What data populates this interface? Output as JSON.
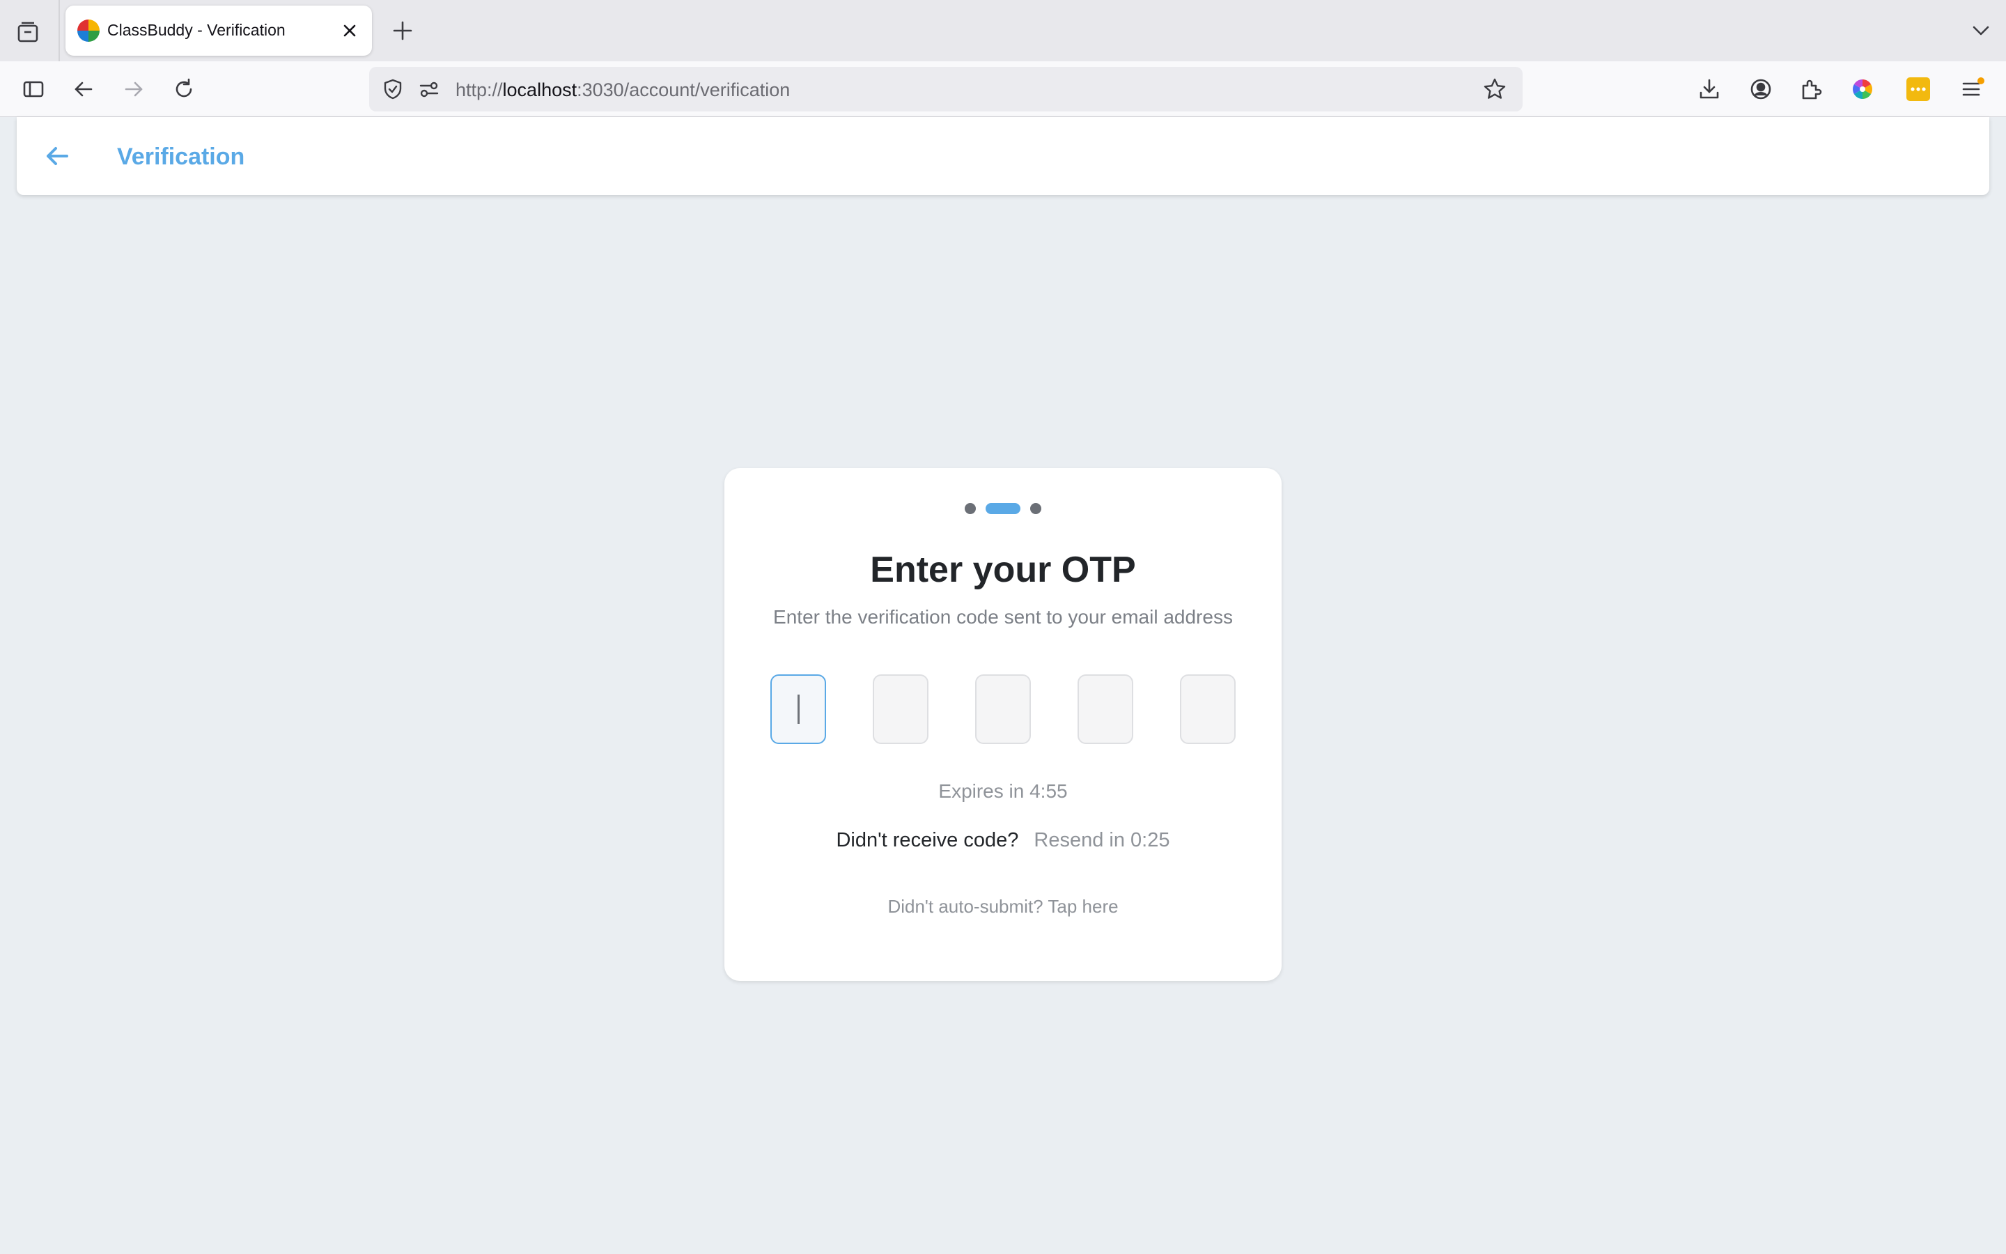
{
  "browser": {
    "tab": {
      "title": "ClassBuddy - Verification"
    },
    "url": {
      "scheme": "http://",
      "host": "localhost",
      "rest": ":3030/account/verification"
    },
    "icons": {
      "tab_tray": "tab-tray-icon",
      "close_tab": "close-icon",
      "new_tab": "plus-icon",
      "tab_list": "chevron-down-icon",
      "sidebar": "sidebar-icon",
      "back": "arrow-left-icon",
      "forward": "arrow-right-icon",
      "reload": "reload-icon",
      "shield": "shield-icon",
      "permissions": "permissions-icon",
      "bookmark": "star-icon",
      "downloads": "download-icon",
      "account": "account-icon",
      "extensions": "puzzle-icon",
      "color_ext": "color-wheel-icon",
      "password_ext": "password-manager-icon",
      "menu": "hamburger-menu-icon"
    }
  },
  "header": {
    "title": "Verification"
  },
  "card": {
    "steps": {
      "total": 3,
      "current": 2
    },
    "title": "Enter your OTP",
    "subtitle": "Enter the verification code sent to your email address",
    "otp": {
      "length": 5,
      "digits": [
        "",
        "",
        "",
        "",
        ""
      ],
      "focused_index": 0
    },
    "expires_text": "Expires in 4:55",
    "resend_question": "Didn't receive code?",
    "resend_timer": "Resend in 0:25",
    "autosubmit_text": "Didn't auto-submit? Tap here"
  },
  "colors": {
    "accent": "#5aa9e6",
    "page_background": "#eaeef2",
    "title_text": "#222529",
    "muted_text": "#8f9399"
  }
}
